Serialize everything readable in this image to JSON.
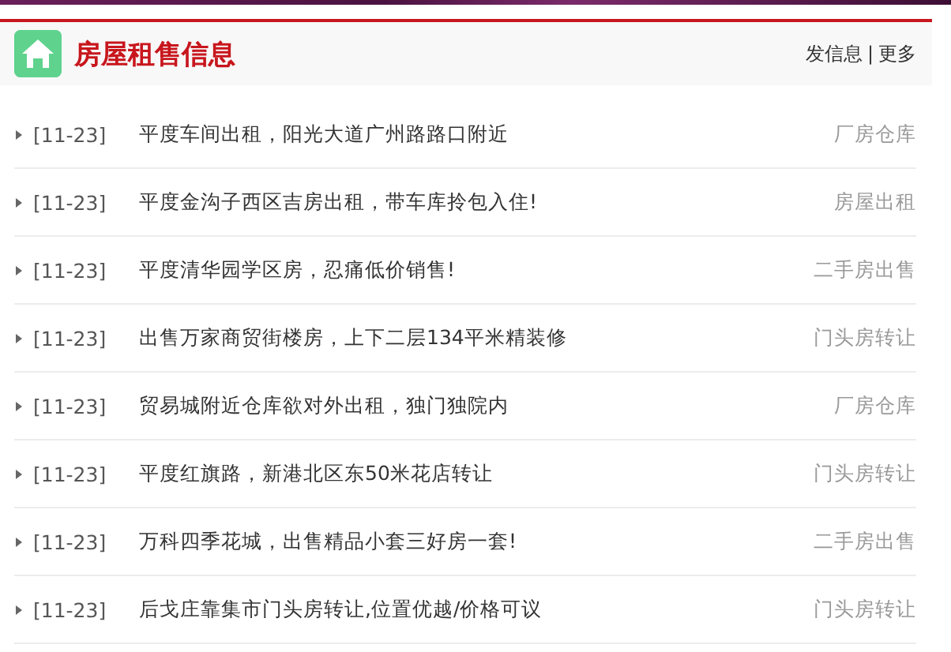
{
  "header": {
    "title": "房屋租售信息",
    "links": [
      "发信息",
      "更多"
    ],
    "separator": "|"
  },
  "items": [
    {
      "date": "[11-23]",
      "title": "平度车间出租，阳光大道广州路路口附近",
      "category": "厂房仓库"
    },
    {
      "date": "[11-23]",
      "title": "平度金沟子西区吉房出租，带车库拎包入住!",
      "category": "房屋出租"
    },
    {
      "date": "[11-23]",
      "title": "平度清华园学区房，忍痛低价销售!",
      "category": "二手房出售"
    },
    {
      "date": "[11-23]",
      "title": "出售万家商贸街楼房，上下二层134平米精装修",
      "category": "门头房转让"
    },
    {
      "date": "[11-23]",
      "title": "贸易城附近仓库欲对外出租，独门独院内",
      "category": "厂房仓库"
    },
    {
      "date": "[11-23]",
      "title": "平度红旗路，新港北区东50米花店转让",
      "category": "门头房转让"
    },
    {
      "date": "[11-23]",
      "title": "万科四季花城，出售精品小套三好房一套!",
      "category": "二手房出售"
    },
    {
      "date": "[11-23]",
      "title": "后戈庄靠集市门头房转让,位置优越/价格可议",
      "category": "门头房转让"
    }
  ]
}
